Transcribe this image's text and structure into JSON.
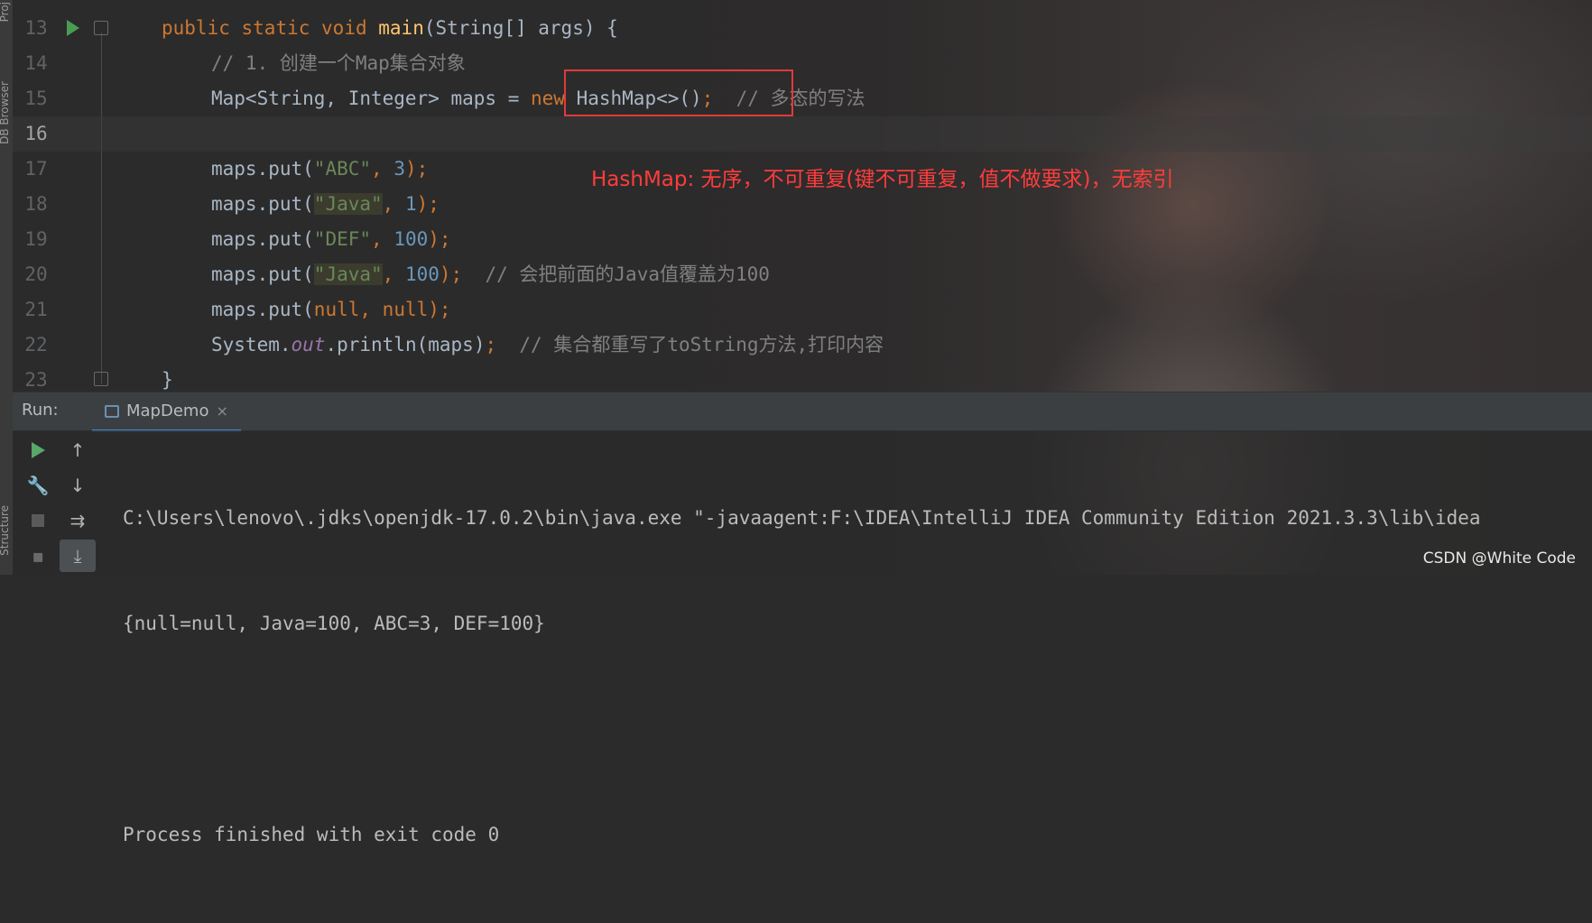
{
  "left_strip": {
    "top_label": "Proj",
    "db_label": "DB Browser",
    "structure_label": "Structure"
  },
  "editor": {
    "lines": [
      {
        "number": "13"
      },
      {
        "number": "14"
      },
      {
        "number": "15"
      },
      {
        "number": "16"
      },
      {
        "number": "17"
      },
      {
        "number": "18"
      },
      {
        "number": "19"
      },
      {
        "number": "20"
      },
      {
        "number": "21"
      },
      {
        "number": "22"
      },
      {
        "number": "23"
      }
    ],
    "tokens": {
      "l13": {
        "public": "public",
        "static": "static",
        "void": "void",
        "main": "main",
        "sig": "(String[] args) {"
      },
      "l14": {
        "comment": "// 1. 创建一个Map集合对象"
      },
      "l15": {
        "decl": "Map<String, Integer> maps = ",
        "new": "new",
        "ctor": " HashMap<>()",
        "semi": ";",
        "comment": "  // 多态的写法"
      },
      "l17": {
        "call": "maps.put(",
        "str": "\"ABC\"",
        "comma": ", ",
        "num": "3",
        "end": ");"
      },
      "l18": {
        "call": "maps.put(",
        "str": "\"Java\"",
        "comma": ", ",
        "num": "1",
        "end": ");"
      },
      "l19": {
        "call": "maps.put(",
        "str": "\"DEF\"",
        "comma": ", ",
        "num": "100",
        "end": ");"
      },
      "l20": {
        "call": "maps.put(",
        "str": "\"Java\"",
        "comma": ", ",
        "num": "100",
        "end": ");",
        "comment": "  // 会把前面的Java值覆盖为100"
      },
      "l21": {
        "call": "maps.put(",
        "null1": "null",
        "comma": ", ",
        "null2": "null",
        "end": ");"
      },
      "l22": {
        "sys": "System.",
        "out": "out",
        "print": ".println(maps)",
        "semi": ";",
        "comment": "  // 集合都重写了toString方法,打印内容"
      },
      "l23": {
        "brace": "}"
      }
    }
  },
  "annotation": "HashMap: 无序，不可重复(键不可重复，值不做要求)，无索引",
  "run_panel": {
    "title": "Run:",
    "tab_label": "MapDemo",
    "tab_close": "×",
    "console_lines": [
      "C:\\Users\\lenovo\\.jdks\\openjdk-17.0.2\\bin\\java.exe \"-javaagent:F:\\IDEA\\IntelliJ IDEA Community Edition 2021.3.3\\lib\\idea",
      "{null=null, Java=100, ABC=3, DEF=100}",
      "",
      "Process finished with exit code 0"
    ],
    "tools_left": [
      "play-icon",
      "wrench-icon",
      "stop-icon",
      "camera-icon"
    ],
    "tools_right": [
      "arrow-up-icon",
      "arrow-down-icon",
      "soft-wrap-icon",
      "scroll-to-end-icon"
    ]
  },
  "watermark": "CSDN @White Code",
  "colors": {
    "keyword": "#cc7832",
    "string": "#6a8759",
    "number": "#6897bb",
    "comment": "#808080",
    "function": "#ffc66d",
    "annotation": "#ff3c3c",
    "highlight_box": "#e03a3a"
  }
}
